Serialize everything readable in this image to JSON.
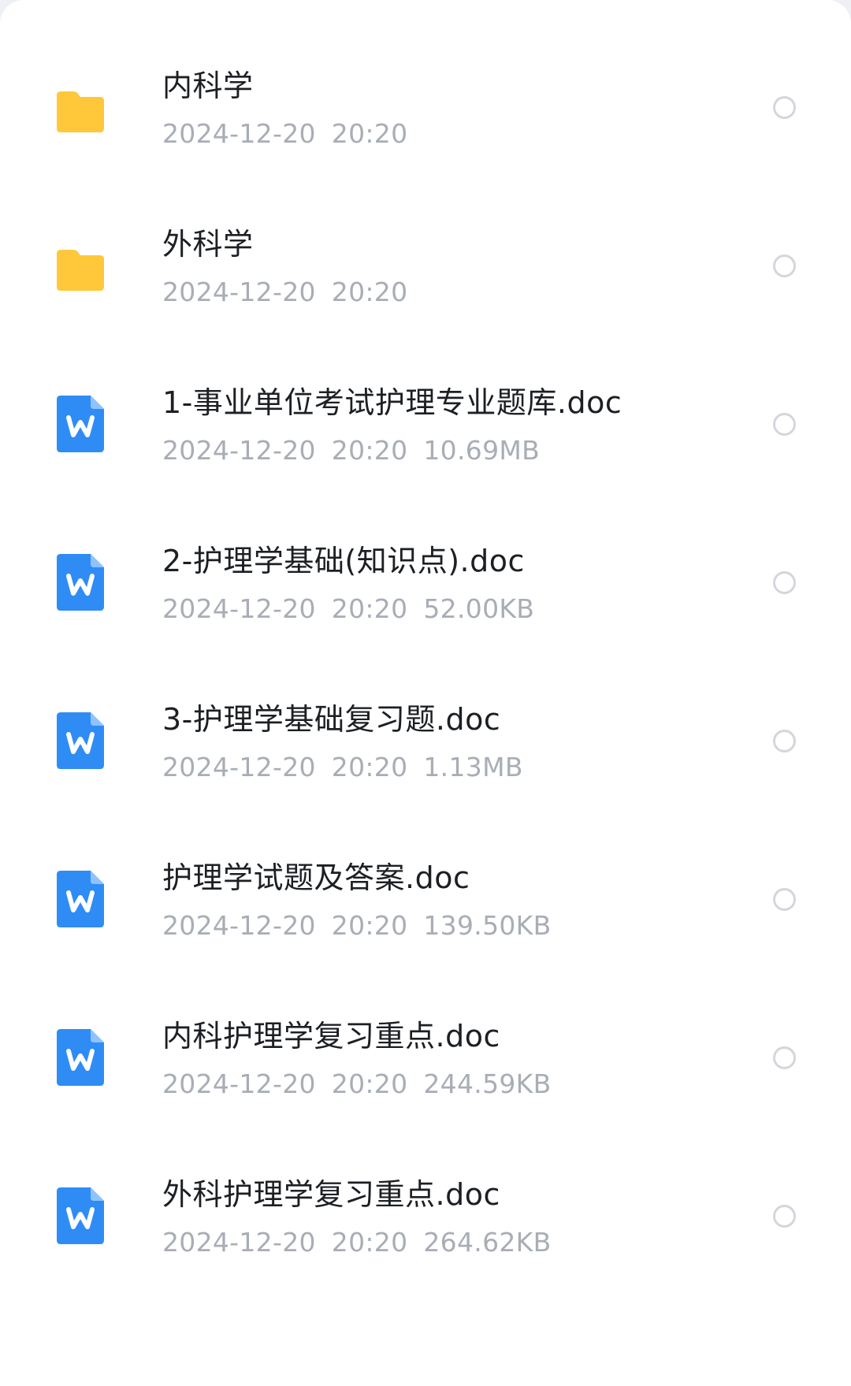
{
  "colors": {
    "folder": "#ffc83a",
    "doc": "#2f8cf5",
    "title": "#1c1f23",
    "meta": "#a8adb6",
    "radio": "#d3d6dc"
  },
  "files": [
    {
      "type": "folder",
      "icon": "folder-icon",
      "name": "内科学",
      "date": "2024-12-20",
      "time": "20:20",
      "size": ""
    },
    {
      "type": "folder",
      "icon": "folder-icon",
      "name": "外科学",
      "date": "2024-12-20",
      "time": "20:20",
      "size": ""
    },
    {
      "type": "doc",
      "icon": "word-doc-icon",
      "name": "1-事业单位考试护理专业题库.doc",
      "date": "2024-12-20",
      "time": "20:20",
      "size": "10.69MB"
    },
    {
      "type": "doc",
      "icon": "word-doc-icon",
      "name": "2-护理学基础(知识点).doc",
      "date": "2024-12-20",
      "time": "20:20",
      "size": "52.00KB"
    },
    {
      "type": "doc",
      "icon": "word-doc-icon",
      "name": "3-护理学基础复习题.doc",
      "date": "2024-12-20",
      "time": "20:20",
      "size": "1.13MB"
    },
    {
      "type": "doc",
      "icon": "word-doc-icon",
      "name": "护理学试题及答案.doc",
      "date": "2024-12-20",
      "time": "20:20",
      "size": "139.50KB"
    },
    {
      "type": "doc",
      "icon": "word-doc-icon",
      "name": "内科护理学复习重点.doc",
      "date": "2024-12-20",
      "time": "20:20",
      "size": "244.59KB"
    },
    {
      "type": "doc",
      "icon": "word-doc-icon",
      "name": "外科护理学复习重点.doc",
      "date": "2024-12-20",
      "time": "20:20",
      "size": "264.62KB"
    }
  ]
}
